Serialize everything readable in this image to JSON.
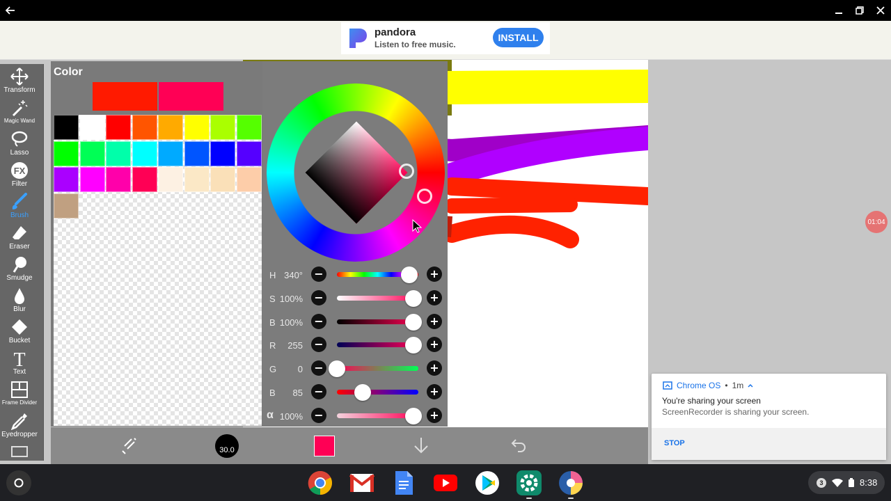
{
  "window": {
    "back_icon": "arrow-left-icon",
    "controls": [
      "minimize-icon",
      "restore-icon",
      "close-icon"
    ]
  },
  "ad": {
    "brand": "pandora",
    "tagline": "Listen to free music.",
    "install_label": "INSTALL",
    "brand_color": "#224099",
    "button_color": "#2f80ed"
  },
  "toolbar": {
    "tools": [
      {
        "label": "Transform",
        "icon": "move-icon"
      },
      {
        "label": "Magic Wand",
        "icon": "magic-wand-icon"
      },
      {
        "label": "Lasso",
        "icon": "lasso-icon"
      },
      {
        "label": "Filter",
        "icon": "fx-icon"
      },
      {
        "label": "Brush",
        "icon": "brush-icon",
        "active": true
      },
      {
        "label": "Eraser",
        "icon": "eraser-icon"
      },
      {
        "label": "Smudge",
        "icon": "smudge-icon"
      },
      {
        "label": "Blur",
        "icon": "blur-drop-icon"
      },
      {
        "label": "Bucket",
        "icon": "bucket-icon"
      },
      {
        "label": "Text",
        "icon": "text-icon"
      },
      {
        "label": "Frame Divider",
        "icon": "frame-divider-icon"
      },
      {
        "label": "Eyedropper",
        "icon": "eyedropper-icon"
      }
    ],
    "active_color": "#3aa0ff"
  },
  "color_panel": {
    "title": "Color",
    "previous_color": "#ff1a00",
    "current_color": "#ff0055",
    "palette": [
      "#000000",
      "#ffffff",
      "#ff0000",
      "#ff5500",
      "#ffaa00",
      "#ffff00",
      "#aaff00",
      "#55ff00",
      "#00ff00",
      "#00ff55",
      "#00ffaa",
      "#00ffff",
      "#00aaff",
      "#0055ff",
      "#0000ff",
      "#5500ff",
      "#aa00ff",
      "#ff00ff",
      "#ff00aa",
      "#ff0055",
      "#fdf1e3",
      "#fbe8c6",
      "#fae0b8",
      "#fdcda9",
      "#c0a081"
    ],
    "sliders": [
      {
        "name": "H",
        "value": "340°",
        "level": 0.944,
        "track": "linear-gradient(to right,#ff0000,#ffff00,#00ff00,#00ffff,#0000ff,#ff00ff,#ff0000)"
      },
      {
        "name": "S",
        "value": "100%",
        "level": 1.0,
        "track": "linear-gradient(to right,#ffffff,#ff0055)"
      },
      {
        "name": "B",
        "value": "100%",
        "level": 1.0,
        "track": "linear-gradient(to right,#000000,#ff0055)"
      },
      {
        "name": "R",
        "value": "255",
        "level": 1.0,
        "track": "linear-gradient(to right,#000055,#ff0055)"
      },
      {
        "name": "G",
        "value": "0",
        "level": 0.0,
        "track": "linear-gradient(to right,#ff0055,#00ff55)"
      },
      {
        "name": "B",
        "value": "85",
        "level": 0.333,
        "track": "linear-gradient(to right,#ff0000,#0000ff)"
      },
      {
        "name": "α",
        "value": "100%",
        "level": 1.0,
        "track": "linear-gradient(to right,#f4d3dd,#ff0055)"
      }
    ],
    "minus_label": "−",
    "plus_label": "+"
  },
  "bottom_bar": {
    "brush_size": "30.0",
    "current_color": "#ff0055",
    "icons": [
      "swap-colors-icon",
      "brush-size-icon",
      "color-swatch-icon",
      "download-icon",
      "undo-icon"
    ]
  },
  "recording_badge": "01:04",
  "notification": {
    "source": "Chrome OS",
    "time": "1m",
    "title": "You're sharing your screen",
    "body": "ScreenRecorder is sharing your screen.",
    "action": "STOP"
  },
  "shelf": {
    "apps": [
      "chrome-icon",
      "gmail-icon",
      "docs-icon",
      "youtube-icon",
      "play-store-icon",
      "settings-icon",
      "ibispaint-icon"
    ],
    "notification_count": "3",
    "time": "8:38"
  }
}
